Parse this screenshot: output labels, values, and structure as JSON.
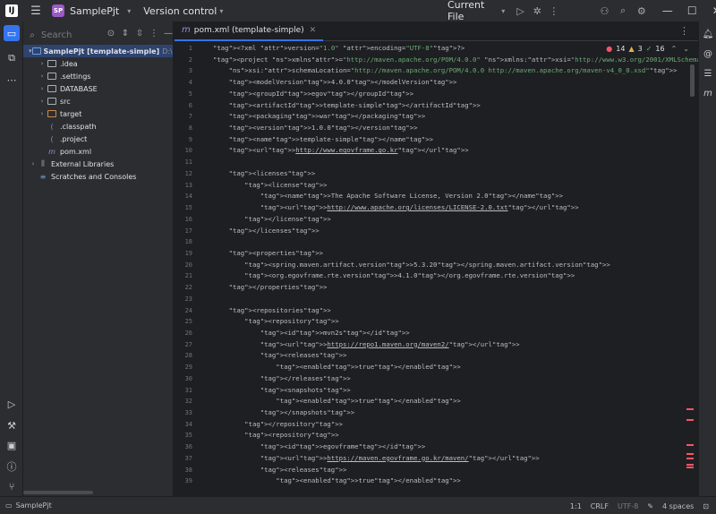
{
  "titlebar": {
    "logo": "IJ",
    "project_badge": "SP",
    "project_name": "SamplePjt",
    "version_control": "Version control",
    "current_file": "Current File"
  },
  "project_panel": {
    "search_placeholder": "Search",
    "tree": [
      {
        "label": "SamplePjt [template-simple]",
        "suffix": "D:\\study\\",
        "level": 0,
        "arrow": "open",
        "icon": "folder",
        "selected": true,
        "bold": true
      },
      {
        "label": ".idea",
        "level": 1,
        "arrow": "closed",
        "icon": "folder"
      },
      {
        "label": ".settings",
        "level": 1,
        "arrow": "closed",
        "icon": "folder"
      },
      {
        "label": "DATABASE",
        "level": 1,
        "arrow": "closed",
        "icon": "folder"
      },
      {
        "label": "src",
        "level": 1,
        "arrow": "closed",
        "icon": "folder"
      },
      {
        "label": "target",
        "level": 1,
        "arrow": "closed",
        "icon": "folder-orange"
      },
      {
        "label": ".classpath",
        "level": 1,
        "arrow": "none",
        "icon": "file"
      },
      {
        "label": ".project",
        "level": 1,
        "arrow": "none",
        "icon": "file"
      },
      {
        "label": "pom.xml",
        "level": 1,
        "arrow": "none",
        "icon": "maven"
      },
      {
        "label": "External Libraries",
        "level": 0,
        "arrow": "closed",
        "icon": "library"
      },
      {
        "label": "Scratches and Consoles",
        "level": 0,
        "arrow": "none",
        "icon": "scratch"
      }
    ]
  },
  "editor": {
    "tab_label": "pom.xml (template-simple)",
    "inspections": {
      "errors": "14",
      "warnings": "3",
      "ok": "16"
    },
    "line_numbers": [
      "1",
      "2",
      "3",
      "4",
      "5",
      "6",
      "7",
      "8",
      "9",
      "10",
      "11",
      "12",
      "13",
      "14",
      "15",
      "16",
      "17",
      "18",
      "19",
      "20",
      "21",
      "22",
      "23",
      "24",
      "25",
      "26",
      "27",
      "28",
      "29",
      "30",
      "31",
      "32",
      "33",
      "34",
      "35",
      "36",
      "37",
      "38",
      "39"
    ],
    "lines": [
      "<?xml version=\"1.0\" encoding=\"UTF-8\"?>",
      "<project xmlns=\"http://maven.apache.org/POM/4.0.0\" xmlns:xsi=\"http://www.w3.org/2001/XMLSchema-instance\"",
      "    xsi:schemaLocation=\"http://maven.apache.org/POM/4.0.0 http://maven.apache.org/maven-v4_0_0.xsd\">",
      "    <modelVersion>4.0.0</modelVersion>",
      "    <groupId>egov</groupId>",
      "    <artifactId>template-simple</artifactId>",
      "    <packaging>war</packaging>",
      "    <version>1.0.0</version>",
      "    <name>template-simple</name>",
      "    <url>http://www.egovframe.go.kr</url>",
      "",
      "    <licenses>",
      "        <license>",
      "            <name>The Apache Software License, Version 2.0</name>",
      "            <url>http://www.apache.org/licenses/LICENSE-2.0.txt</url>",
      "        </license>",
      "    </licenses>",
      "",
      "    <properties>",
      "        <spring.maven.artifact.version>5.3.20</spring.maven.artifact.version>",
      "        <org.egovframe.rte.version>4.1.0</org.egovframe.rte.version>",
      "    </properties>",
      "",
      "    <repositories>",
      "        <repository>",
      "            <id>mvn2s</id>",
      "            <url>https://repo1.maven.org/maven2/</url>",
      "            <releases>",
      "                <enabled>true</enabled>",
      "            </releases>",
      "            <snapshots>",
      "                <enabled>true</enabled>",
      "            </snapshots>",
      "        </repository>",
      "        <repository>",
      "            <id>egovframe</id>",
      "            <url>https://maven.egovframe.go.kr/maven/</url>",
      "            <releases>",
      "                <enabled>true</enabled>"
    ]
  },
  "statusbar": {
    "project": "SamplePjt",
    "position": "1:1",
    "line_ending": "CRLF",
    "encoding": "UTF-8",
    "indent": "4 spaces"
  },
  "colors": {
    "accent": "#3574f0",
    "error": "#f75464",
    "tag": "#d5b778",
    "string": "#6aab73"
  }
}
